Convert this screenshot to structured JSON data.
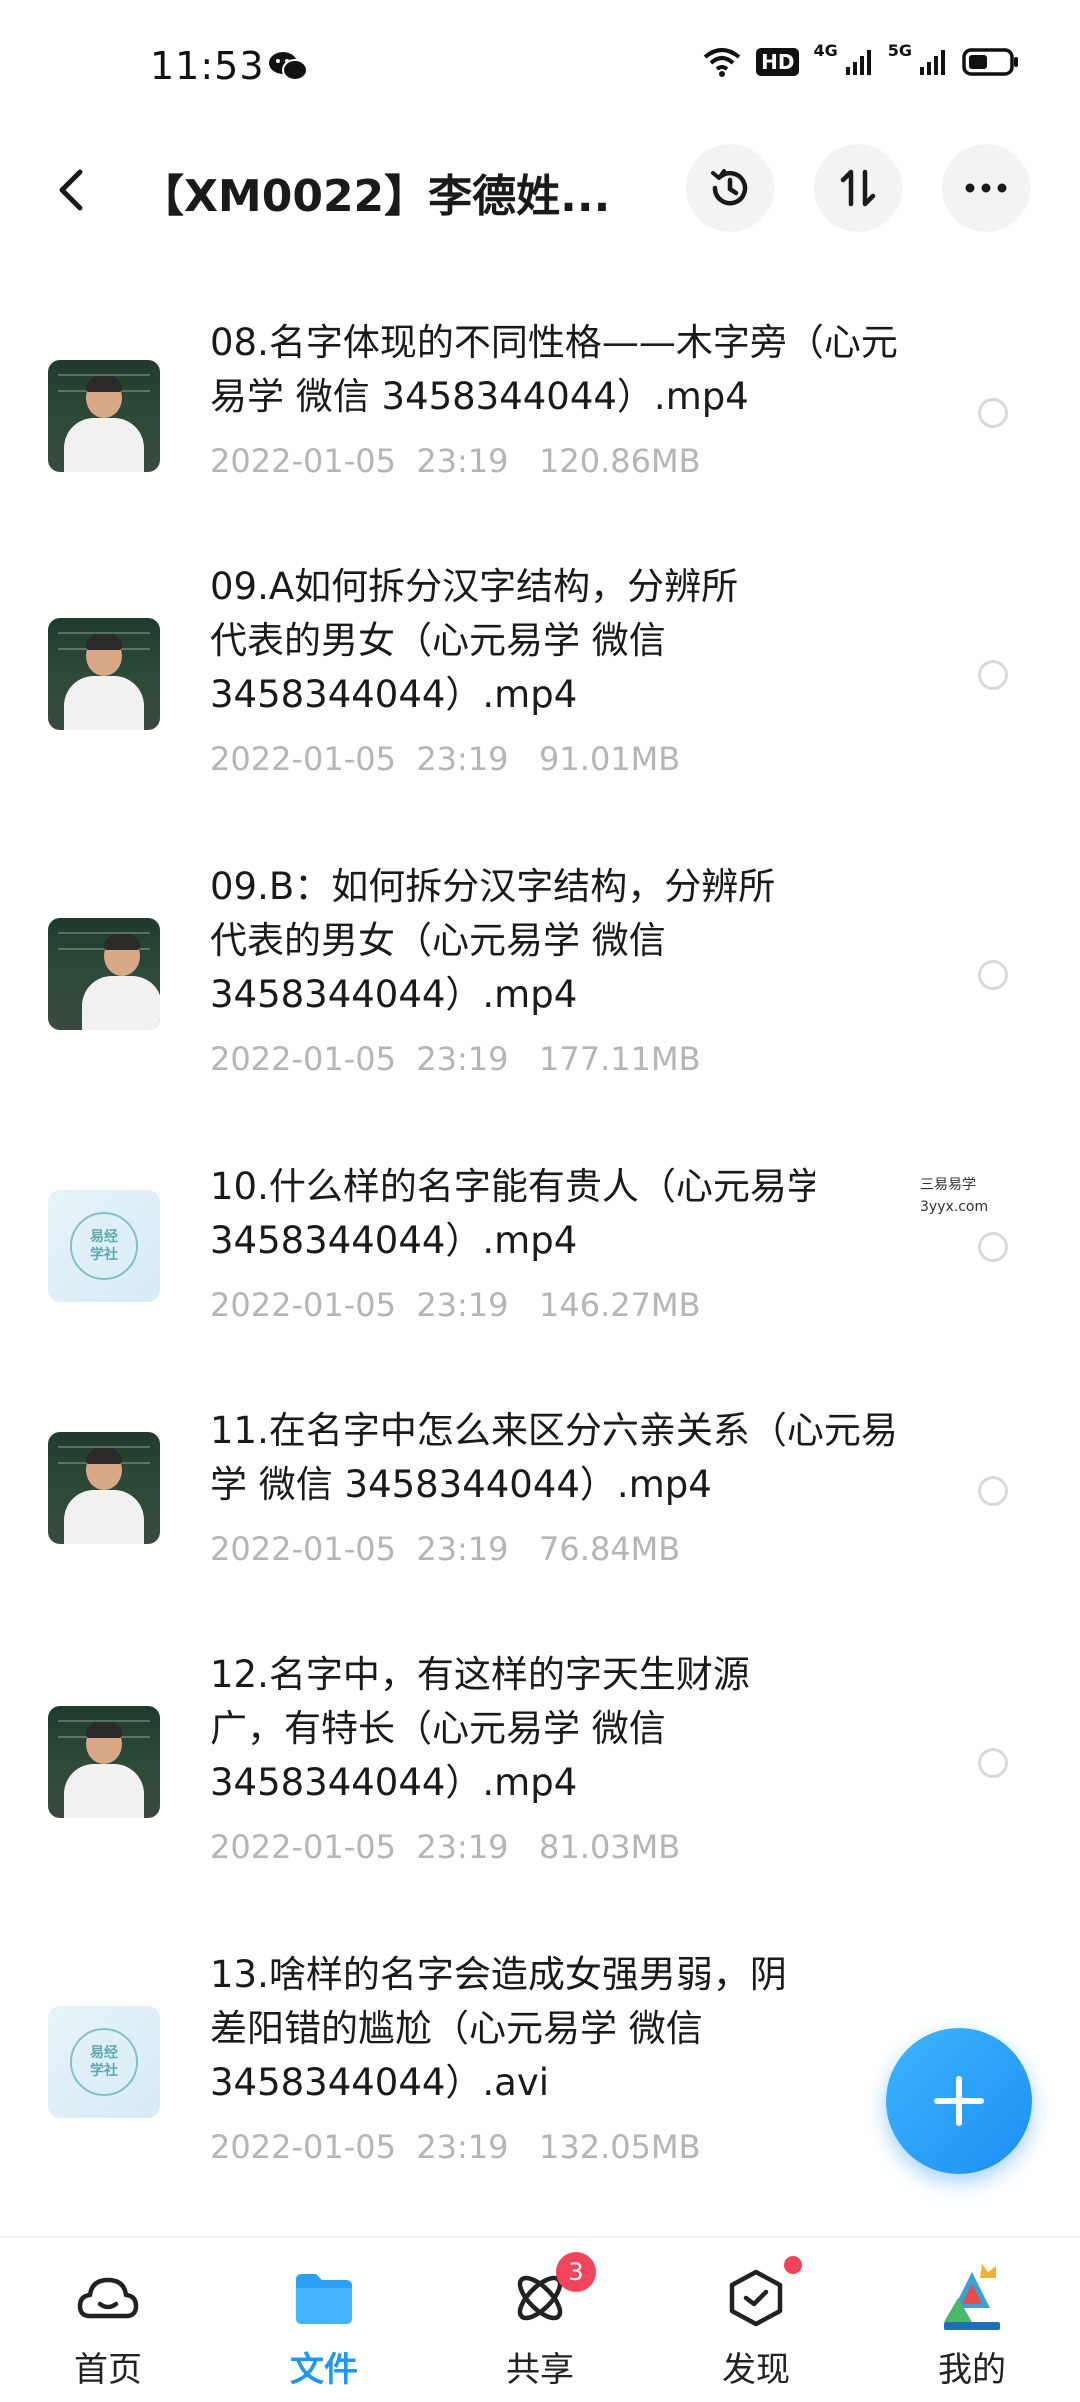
{
  "status_bar": {
    "time": "11:53",
    "hd_label": "HD",
    "net_4g": "4G",
    "net_5g": "5G"
  },
  "header": {
    "title": "【XM0022】李德姓...",
    "icons": [
      "back-icon",
      "history-icon",
      "sort-icon",
      "more-icon"
    ]
  },
  "files": [
    {
      "name": "08.名字体现的不同性格——木字旁（心元易学 微信 3458344044）.mp4",
      "date": "2022-01-05  23:19",
      "size": "120.86MB",
      "thumb": "video"
    },
    {
      "name": "09.A如何拆分汉字结构，分辨所代表的男女（心元易学 微信 3458344044）.mp4",
      "date": "2022-01-05  23:19",
      "size": "91.01MB",
      "thumb": "video"
    },
    {
      "name": "09.B：如何拆分汉字结构，分辨所代表的男女（心元易学 微信 3458344044）.mp4",
      "date": "2022-01-05  23:19",
      "size": "177.11MB",
      "thumb": "video"
    },
    {
      "name": "10.什么样的名字能有贵人（心元易学 微信 3458344044）.mp4",
      "date": "2022-01-05  23:19",
      "size": "146.27MB",
      "thumb": "logo"
    },
    {
      "name": "11.在名字中怎么来区分六亲关系（心元易学 微信 3458344044）.mp4",
      "date": "2022-01-05  23:19",
      "size": "76.84MB",
      "thumb": "video"
    },
    {
      "name": "12.名字中，有这样的字天生财源广，有特长（心元易学 微信 3458344044）.mp4",
      "date": "2022-01-05  23:19",
      "size": "81.03MB",
      "thumb": "video"
    },
    {
      "name": "13.啥样的名字会造成女强男弱，阴差阳错的尴尬（心元易学 微信 3458344044）.avi",
      "date": "2022-01-05  23:19",
      "size": "132.05MB",
      "thumb": "logo"
    }
  ],
  "logo_thumb_text": {
    "line1": "易经",
    "line2": "学社"
  },
  "watermark": {
    "line1": "三易易学",
    "line2": "3yyx.com"
  },
  "fab": {
    "icon": "plus-icon"
  },
  "bottom_nav": [
    {
      "label": "首页",
      "icon": "home-cloud-icon",
      "active": false
    },
    {
      "label": "文件",
      "icon": "folder-icon",
      "active": true
    },
    {
      "label": "共享",
      "icon": "share-atom-icon",
      "active": false,
      "badge": "3"
    },
    {
      "label": "发现",
      "icon": "discover-cube-icon",
      "active": false,
      "dot": true
    },
    {
      "label": "我的",
      "icon": "avatar-icon",
      "active": false
    }
  ],
  "colors": {
    "accent": "#2196f3",
    "badge": "#f2445d",
    "meta_text": "#b5b5b5"
  }
}
